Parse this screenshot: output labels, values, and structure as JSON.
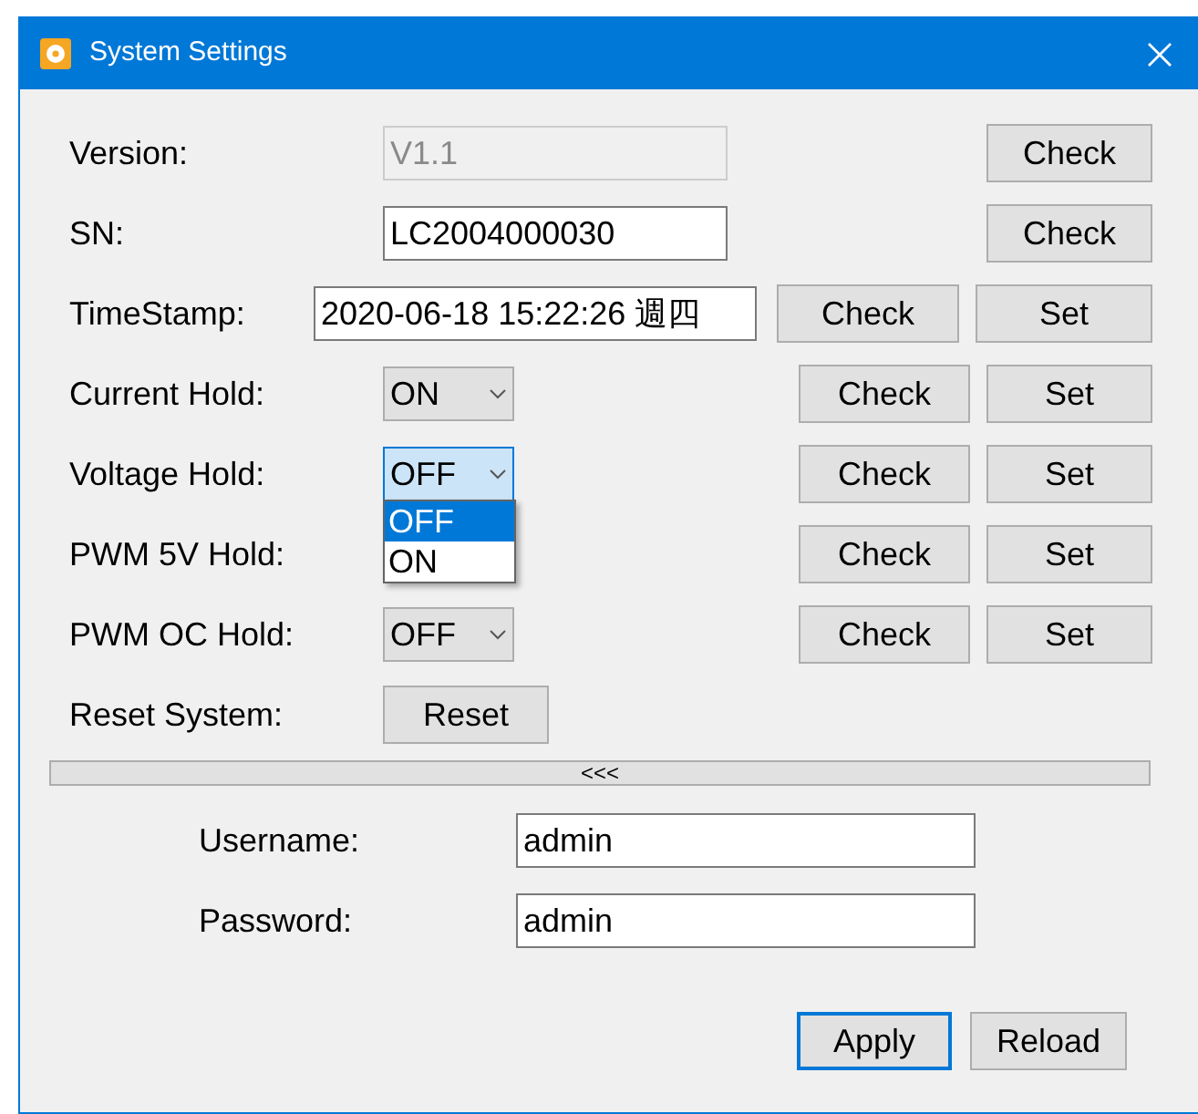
{
  "window": {
    "title": "System Settings"
  },
  "rows": [
    {
      "label": "Version:",
      "control": {
        "kind": "field",
        "value": "V1.1",
        "disabled": true
      },
      "buttons": [
        "Check"
      ]
    },
    {
      "label": "SN:",
      "control": {
        "kind": "field",
        "value": "LC2004000030",
        "disabled": false
      },
      "buttons": [
        "Check"
      ]
    },
    {
      "label": "TimeStamp:",
      "control": {
        "kind": "datetime",
        "value": "2020-06-18 15:22:26 週四"
      },
      "buttons": [
        "Check",
        "Set"
      ]
    },
    {
      "label": "Current Hold:",
      "control": {
        "kind": "select",
        "value": "ON",
        "open": false
      },
      "buttons": [
        "Check",
        "Set"
      ]
    },
    {
      "label": "Voltage Hold:",
      "control": {
        "kind": "select",
        "value": "OFF",
        "open": true,
        "options": [
          {
            "label": "OFF",
            "selected": true
          },
          {
            "label": "ON",
            "selected": false
          }
        ]
      },
      "buttons": [
        "Check",
        "Set"
      ]
    },
    {
      "label": "PWM 5V Hold:",
      "control": {
        "kind": "covered"
      },
      "buttons": [
        "Check",
        "Set"
      ]
    },
    {
      "label": "PWM OC Hold:",
      "control": {
        "kind": "select",
        "value": "OFF",
        "open": false
      },
      "buttons": [
        "Check",
        "Set"
      ]
    },
    {
      "label": "Reset System:",
      "control": {
        "kind": "button",
        "label": "Reset"
      },
      "buttons": []
    }
  ],
  "splitter": {
    "label": "<<<"
  },
  "login": [
    {
      "label": "Username:",
      "value": "admin"
    },
    {
      "label": "Password:",
      "value": "admin"
    }
  ],
  "actions": [
    {
      "label": "Apply",
      "default": true
    },
    {
      "label": "Reload",
      "default": false
    }
  ]
}
